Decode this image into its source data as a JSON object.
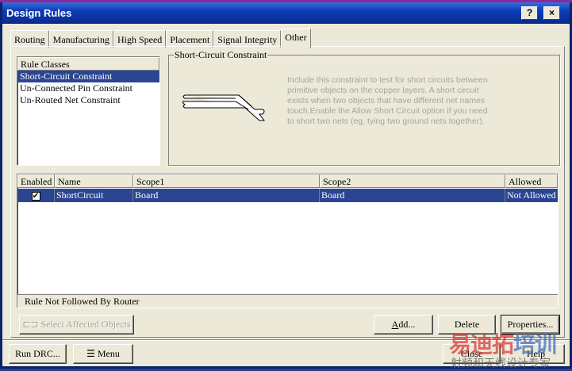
{
  "window": {
    "title": "Design Rules",
    "help_button": "?",
    "close_button": "×"
  },
  "tabs": [
    {
      "label": "Routing"
    },
    {
      "label": "Manufacturing"
    },
    {
      "label": "High Speed"
    },
    {
      "label": "Placement"
    },
    {
      "label": "Signal Integrity"
    },
    {
      "label": "Other",
      "active": true
    }
  ],
  "rule_classes": {
    "header": "Rule Classes",
    "items": [
      "Short-Circuit Constraint",
      "Un-Connected Pin Constraint",
      "Un-Routed Net Constraint"
    ],
    "selected": 0
  },
  "constraint": {
    "title": "Short-Circuit Constraint",
    "icon": "short-circuit-traces-icon",
    "description": "Include this constraint to test for short circuits between primitive objects on the copper layers. A short circuit exists when two objects that have different net names touch.Enable the Allow Short Circuit option if you need to short two nets (eg, tying two ground nets together)."
  },
  "table": {
    "columns": [
      "Enabled",
      "Name",
      "Scope1",
      "Scope2",
      "Allowed"
    ],
    "rows": [
      {
        "enabled": true,
        "name": "ShortCircuit",
        "scope1": "Board",
        "scope2": "Board",
        "allowed": "Not Allowed"
      }
    ],
    "status": "Rule Not Followed By Router"
  },
  "buttons": {
    "select_affected": "Select Affected Objects",
    "add": "Add...",
    "delete": "Delete",
    "properties": "Properties...",
    "run_drc": "Run DRC...",
    "menu": "Menu",
    "close": "Close",
    "help": "Help"
  },
  "watermark": {
    "main": "易迪拓培训",
    "sub": "射频和天线设计专家"
  },
  "colors": {
    "selection": "#2a4592",
    "titlebar": "#0a3cb8"
  }
}
